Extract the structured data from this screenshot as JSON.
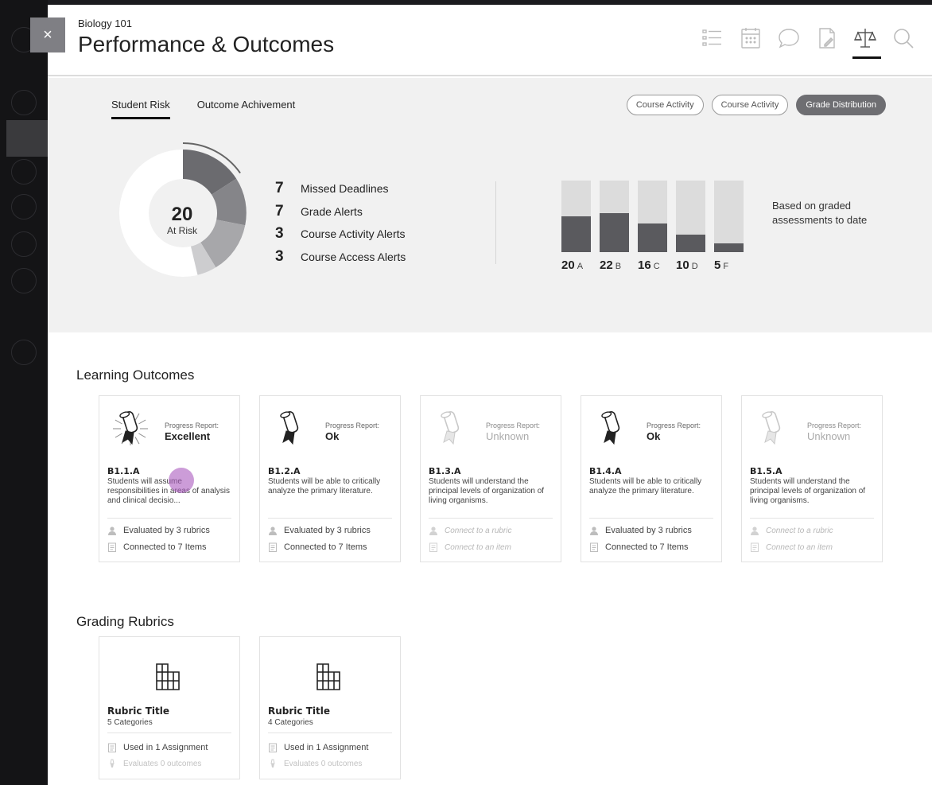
{
  "header": {
    "course": "Biology 101",
    "title": "Performance & Outcomes",
    "close_label": "×"
  },
  "nav_icons": [
    "list-icon",
    "calendar-icon",
    "chat-bubble-icon",
    "document-edit-icon",
    "scales-icon",
    "search-icon"
  ],
  "analytics": {
    "tabs": [
      {
        "label": "Student Risk",
        "active": true
      },
      {
        "label": "Outcome Achivement",
        "active": false
      }
    ],
    "filters": [
      {
        "label": "Course Activity",
        "active": false
      },
      {
        "label": "Course Activity",
        "active": false
      },
      {
        "label": "Grade Distribution",
        "active": true
      }
    ],
    "risk": {
      "count": "20",
      "label": "At Risk"
    },
    "alerts": [
      {
        "count": "7",
        "label": "Missed Deadlines"
      },
      {
        "count": "7",
        "label": "Grade Alerts"
      },
      {
        "count": "3",
        "label": "Course Activity Alerts"
      },
      {
        "count": "3",
        "label": "Course Access Alerts"
      }
    ],
    "grade_note": "Based on graded assessments to date"
  },
  "chart_data": {
    "type": "bar",
    "categories": [
      "A",
      "B",
      "C",
      "D",
      "F"
    ],
    "values": [
      20,
      22,
      16,
      10,
      5
    ],
    "labels": [
      "20",
      "22",
      "16",
      "10",
      "5"
    ],
    "ylim": [
      0,
      40
    ]
  },
  "learning_outcomes": {
    "title": "Learning Outcomes",
    "cards": [
      {
        "progress_label": "Progress Report:",
        "progress": "Excellent",
        "state": "excellent",
        "code": "B1.1.A",
        "desc": "Students will assume responsibilities in areas of analysis and clinical decisio...",
        "line1": "Evaluated by 3 rubrics",
        "line2": "Connected to 7 Items"
      },
      {
        "progress_label": "Progress Report:",
        "progress": "Ok",
        "state": "ok",
        "code": "B1.2.A",
        "desc": "Students will be able to critically analyze the primary literature.",
        "line1": "Evaluated by 3 rubrics",
        "line2": "Connected to 7 Items"
      },
      {
        "progress_label": "Progress Report:",
        "progress": "Unknown",
        "state": "unknown",
        "code": "B1.3.A",
        "desc": "Students will understand the principal levels of organization of living organisms.",
        "line1": "Connect to a rubric",
        "line2": "Connect to an item"
      },
      {
        "progress_label": "Progress Report:",
        "progress": "Ok",
        "state": "ok",
        "code": "B1.4.A",
        "desc": "Students will be able to critically analyze the primary literature.",
        "line1": "Evaluated by 3 rubrics",
        "line2": "Connected to 7 Items"
      },
      {
        "progress_label": "Progress Report:",
        "progress": "Unknown",
        "state": "unknown",
        "code": "B1.5.A",
        "desc": "Students will understand the principal levels of organization of living organisms.",
        "line1": "Connect to a rubric",
        "line2": "Connect to an item"
      }
    ]
  },
  "grading_rubrics": {
    "title": "Grading Rubrics",
    "cards": [
      {
        "title": "Rubric Title",
        "categories": "5 Categories",
        "line1": "Used in 1 Assignment",
        "line2": "Evaluates 0 outcomes"
      },
      {
        "title": "Rubric Title",
        "categories": "4 Categories",
        "line1": "Used in 1 Assignment",
        "line2": "Evaluates 0 outcomes"
      }
    ]
  },
  "colors": {
    "bar_fill": "#5a5a5e",
    "bar_track": "#dcdcdc",
    "touch_indicator": "#b062c6"
  }
}
